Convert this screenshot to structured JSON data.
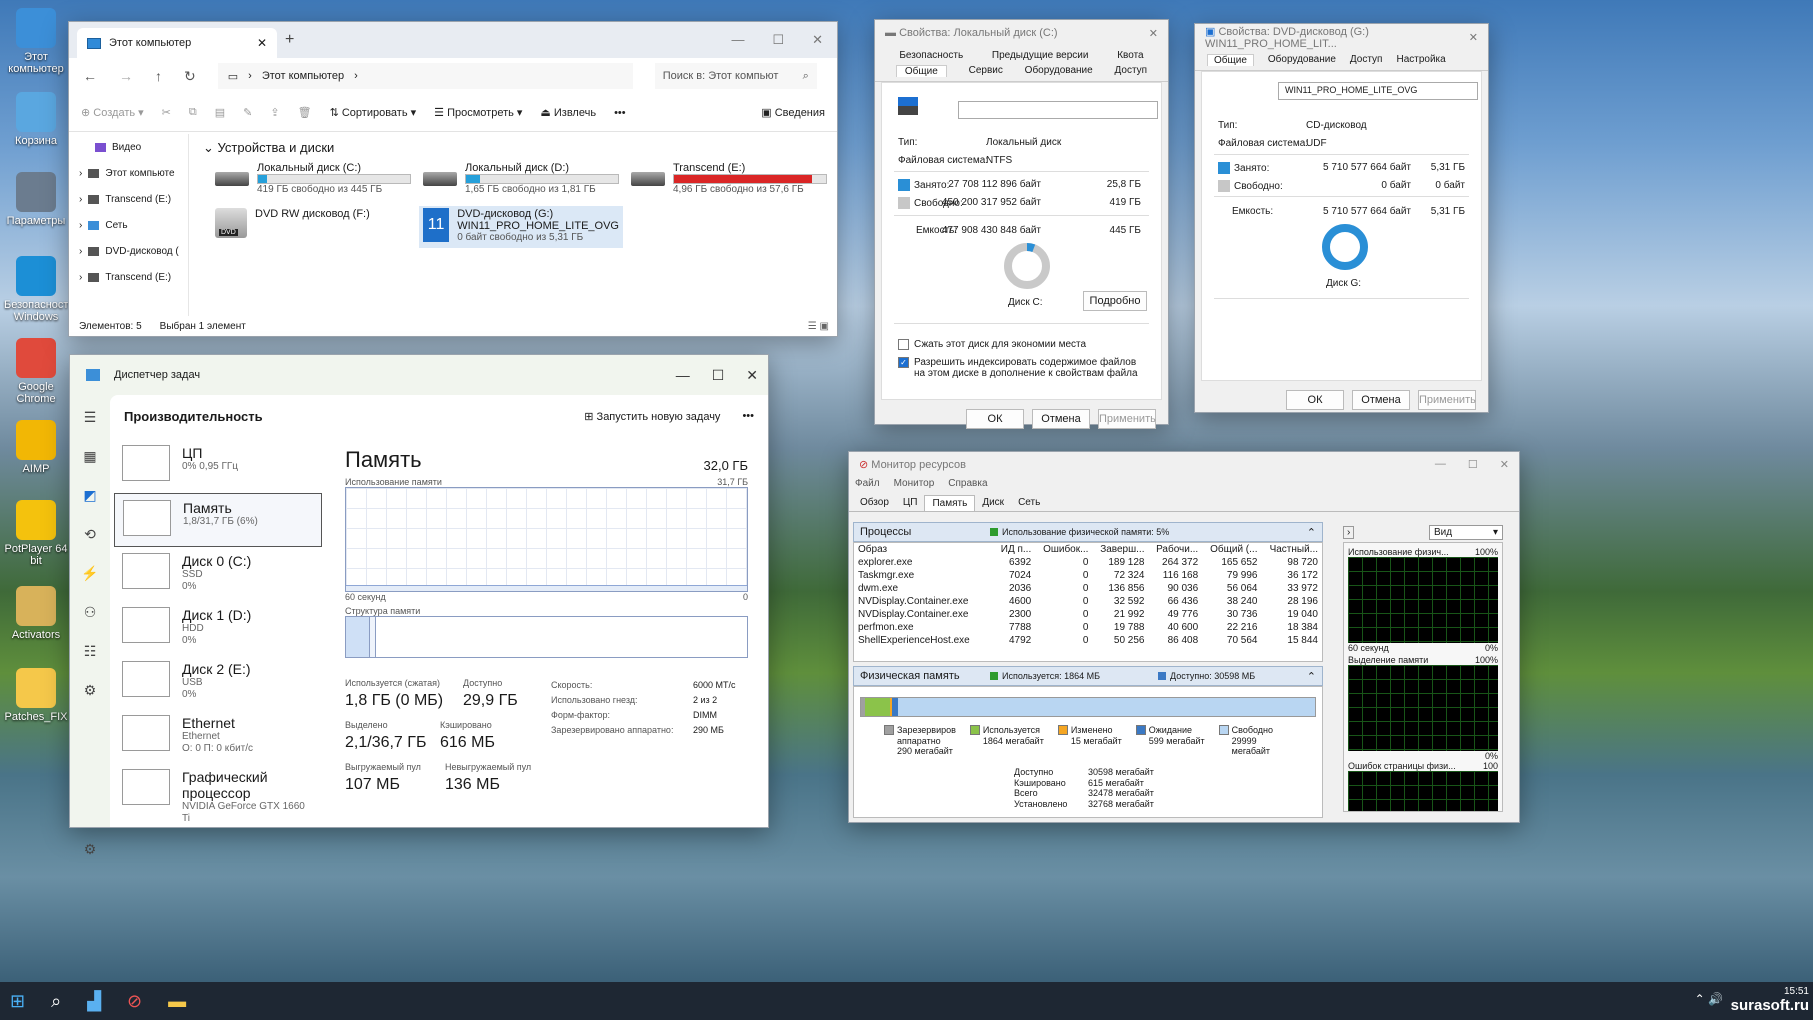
{
  "desktop": {
    "icons": [
      {
        "label": "Этот компьютер",
        "icon": "computer-icon",
        "color": "#3c8fd8"
      },
      {
        "label": "Корзина",
        "icon": "recycle-bin-icon",
        "color": "#5aa7e0"
      },
      {
        "label": "Параметры",
        "icon": "settings-gear-icon",
        "color": "#6b7c8f"
      },
      {
        "label": "Безопасность Windows",
        "icon": "shield-icon",
        "color": "#1c8fd6"
      },
      {
        "label": "Google Chrome",
        "icon": "chrome-icon",
        "color": "#e04a3c"
      },
      {
        "label": "AIMP",
        "icon": "aimp-icon",
        "color": "#f2b705"
      },
      {
        "label": "PotPlayer 64 bit",
        "icon": "potplayer-icon",
        "color": "#f4c20d"
      },
      {
        "label": "Activators",
        "icon": "activators-icon",
        "color": "#d8b25a"
      },
      {
        "label": "Patches_FIX",
        "icon": "folder-icon",
        "color": "#f5c84a"
      }
    ]
  },
  "taskbar": {
    "time": "15:51",
    "watermark": "surasoft.ru"
  },
  "explorer": {
    "tab_title": "Этот компьютер",
    "address": "Этот компьютер",
    "search_placeholder": "Поиск в: Этот компьют",
    "toolbar": {
      "create": "Создать",
      "sort": "Сортировать",
      "view": "Просмотреть",
      "eject": "Извлечь",
      "details": "Сведения"
    },
    "nav": [
      "Видео",
      "Этот компьюте",
      "Transcend (E:)",
      "Сеть",
      "DVD-дисковод (",
      "Transcend (E:)"
    ],
    "section": "Устройства и диски",
    "drives": [
      {
        "name": "Локальный диск (C:)",
        "free": "419 ГБ свободно из 445 ГБ",
        "used_fraction": 0.06,
        "color": "#26a0da"
      },
      {
        "name": "Локальный диск (D:)",
        "free": "1,65 ГБ свободно из 1,81 ГБ",
        "used_fraction": 0.09,
        "color": "#26a0da"
      },
      {
        "name": "Transcend (E:)",
        "free": "4,96 ГБ свободно из 57,6 ГБ",
        "used_fraction": 0.91,
        "color": "#da2626"
      }
    ],
    "dvd_rw": "DVD RW дисковод (F:)",
    "dvd_g": {
      "name": "DVD-дисковод (G:)",
      "label": "WIN11_PRO_HOME_LITE_OVG",
      "free": "0 байт свободно из 5,31 ГБ"
    },
    "status": {
      "count": "Элементов: 5",
      "selected": "Выбран 1 элемент"
    }
  },
  "props_c": {
    "title": "Свойства: Локальный диск (C:)",
    "tabs_row1": [
      "Безопасность",
      "Предыдущие версии",
      "Квота"
    ],
    "tabs_row2": [
      "Общие",
      "Сервис",
      "Оборудование",
      "Доступ"
    ],
    "type_label": "Тип:",
    "type": "Локальный диск",
    "fs_label": "Файловая система:",
    "fs": "NTFS",
    "used_label": "Занято:",
    "used_bytes": "27 708 112 896 байт",
    "used_gb": "25,8 ГБ",
    "free_label": "Свободно:",
    "free_bytes": "450 200 317 952 байт",
    "free_gb": "419 ГБ",
    "cap_label": "Емкость:",
    "cap_bytes": "477 908 430 848 байт",
    "cap_gb": "445 ГБ",
    "disk": "Диск C:",
    "details": "Подробно",
    "compress": "Сжать этот диск для экономии места",
    "index": "Разрешить индексировать содержимое файлов на этом диске в дополнение к свойствам файла",
    "ok": "ОК",
    "cancel": "Отмена",
    "apply": "Применить",
    "used_fraction": 0.058
  },
  "props_g": {
    "title": "Свойства: DVD-дисковод (G:) WIN11_PRO_HOME_LIT...",
    "tabs": [
      "Общие",
      "Оборудование",
      "Доступ",
      "Настройка"
    ],
    "label": "WIN11_PRO_HOME_LITE_OVG",
    "type_label": "Тип:",
    "type": "CD-дисковод",
    "fs_label": "Файловая система:",
    "fs": "UDF",
    "used_label": "Занято:",
    "used_bytes": "5 710 577 664 байт",
    "used_gb": "5,31 ГБ",
    "free_label": "Свободно:",
    "free_bytes": "0 байт",
    "free_gb": "0 байт",
    "cap_label": "Емкость:",
    "cap_bytes": "5 710 577 664 байт",
    "cap_gb": "5,31 ГБ",
    "disk": "Диск G:",
    "ok": "ОК",
    "cancel": "Отмена",
    "apply": "Применить"
  },
  "taskmgr": {
    "title": "Диспетчер задач",
    "heading": "Производительность",
    "run_task": "Запустить новую задачу",
    "items": [
      {
        "name": "ЦП",
        "sub1": "0% 0,95 ГГц",
        "sub2": ""
      },
      {
        "name": "Память",
        "sub1": "1,8/31,7 ГБ (6%)",
        "sub2": ""
      },
      {
        "name": "Диск 0 (C:)",
        "sub1": "SSD",
        "sub2": "0%"
      },
      {
        "name": "Диск 1 (D:)",
        "sub1": "HDD",
        "sub2": "0%"
      },
      {
        "name": "Диск 2 (E:)",
        "sub1": "USB",
        "sub2": "0%"
      },
      {
        "name": "Ethernet",
        "sub1": "Ethernet",
        "sub2": "О: 0 П: 0 кбит/с"
      },
      {
        "name": "Графический процессор",
        "sub1": "NVIDIA GeForce GTX 1660 Ti",
        "sub2": ""
      }
    ],
    "mem_title": "Память",
    "mem_total": "32,0 ГБ",
    "usage_label": "Использование памяти",
    "usage_max": "31,7 ГБ",
    "axis_left": "60 секунд",
    "axis_right": "0",
    "struct_label": "Структура памяти",
    "stats": {
      "in_use_label": "Используется (сжатая)",
      "in_use": "1,8 ГБ (0 МБ)",
      "avail_label": "Доступно",
      "avail": "29,9 ГБ",
      "committed_label": "Выделено",
      "committed": "2,1/36,7 ГБ",
      "cached_label": "Кэшировано",
      "cached": "616 МБ",
      "paged_label": "Выгружаемый пул",
      "paged": "107 МБ",
      "nonpaged_label": "Невыгружаемый пул",
      "nonpaged": "136 МБ",
      "speed_label": "Скорость:",
      "speed": "6000 МТ/с",
      "slots_label": "Использовано гнезд:",
      "slots": "2 из 2",
      "form_label": "Форм-фактор:",
      "form": "DIMM",
      "reserved_label": "Зарезервировано аппаратно:",
      "reserved": "290 МБ"
    }
  },
  "resmon": {
    "title": "Монитор ресурсов",
    "menu": [
      "Файл",
      "Монитор",
      "Справка"
    ],
    "tabs": [
      "Обзор",
      "ЦП",
      "Память",
      "Диск",
      "Сеть"
    ],
    "proc_header": "Процессы",
    "proc_usage": "Использование физической памяти: 5%",
    "columns": [
      "Образ",
      "ИД п...",
      "Ошибок...",
      "Заверш...",
      "Рабочи...",
      "Общий (...",
      "Частный..."
    ],
    "rows": [
      [
        "explorer.exe",
        "6392",
        "0",
        "189 128",
        "264 372",
        "165 652",
        "98 720"
      ],
      [
        "Taskmgr.exe",
        "7024",
        "0",
        "72 324",
        "116 168",
        "79 996",
        "36 172"
      ],
      [
        "dwm.exe",
        "2036",
        "0",
        "136 856",
        "90 036",
        "56 064",
        "33 972"
      ],
      [
        "NVDisplay.Container.exe",
        "4600",
        "0",
        "32 592",
        "66 436",
        "38 240",
        "28 196"
      ],
      [
        "NVDisplay.Container.exe",
        "2300",
        "0",
        "21 992",
        "49 776",
        "30 736",
        "19 040"
      ],
      [
        "perfmon.exe",
        "7788",
        "0",
        "19 788",
        "40 600",
        "22 216",
        "18 384"
      ],
      [
        "ShellExperienceHost.exe",
        "4792",
        "0",
        "50 256",
        "86 408",
        "70 564",
        "15 844"
      ]
    ],
    "phys_header": "Физическая память",
    "phys_used": "Используется: 1864 МБ",
    "phys_avail": "Доступно: 30598 МБ",
    "legend": [
      {
        "l1": "Зарезервиров",
        "l2": "аппаратно",
        "l3": "290 мегабайт",
        "color": "#a0a0a0"
      },
      {
        "l1": "Используется",
        "l2": "1864 мегабайт",
        "l3": "",
        "color": "#8bc34a"
      },
      {
        "l1": "Изменено",
        "l2": "15 мегабайт",
        "l3": "",
        "color": "#f5a623"
      },
      {
        "l1": "Ожидание",
        "l2": "599 мегабайт",
        "l3": "",
        "color": "#3b79c4"
      },
      {
        "l1": "Свободно",
        "l2": "29999",
        "l3": "мегабайт",
        "color": "#b9d6f2"
      }
    ],
    "summary": [
      [
        "Доступно",
        "30598 мегабайт"
      ],
      [
        "Кэшировано",
        "615 мегабайт"
      ],
      [
        "Всего",
        "32478 мегабайт"
      ],
      [
        "Установлено",
        "32768 мегабайт"
      ]
    ],
    "view": "Вид",
    "g1_label": "Использование физич...",
    "g1_pct": "100%",
    "g1_bottom": "60 секунд",
    "g1_zero": "0%",
    "g2_label": "Выделение памяти",
    "g2_pct": "100%",
    "g2_zero": "0%",
    "g3_label": "Ошибок страницы физи...",
    "g3_pct": "100"
  }
}
